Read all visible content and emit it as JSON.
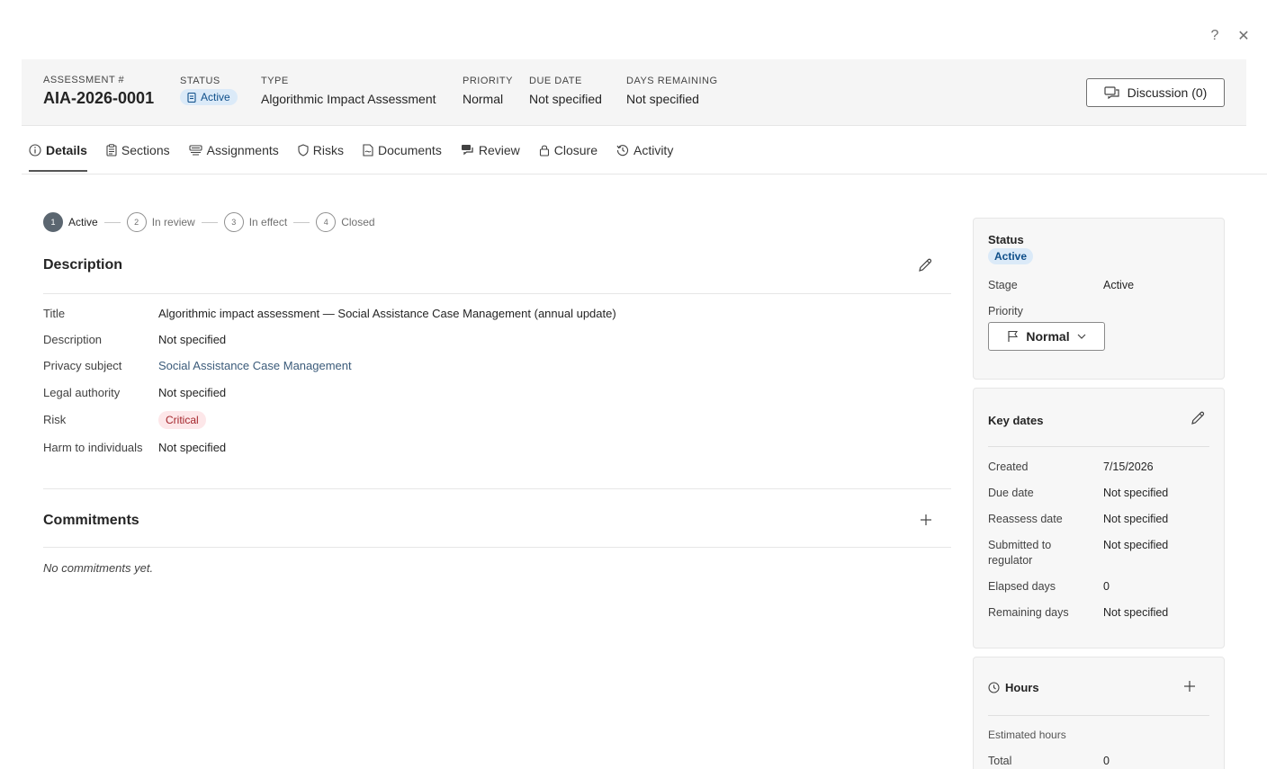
{
  "window": {
    "help_glyph": "?",
    "close_glyph": "✕"
  },
  "header": {
    "assessment_label": "ASSESSMENT #",
    "assessment_id": "AIA-2026-0001",
    "status_label": "STATUS",
    "status_value": "Active",
    "type_label": "TYPE",
    "type_value": "Algorithmic Impact Assessment",
    "priority_label": "PRIORITY",
    "priority_value": "Normal",
    "due_label": "DUE DATE",
    "due_value": "Not specified",
    "remaining_label": "DAYS REMAINING",
    "remaining_value": "Not specified",
    "discussion_label": "Discussion (0)"
  },
  "tabs": [
    {
      "label": "Details",
      "icon": "info-icon",
      "active": true
    },
    {
      "label": "Sections",
      "icon": "clipboard-icon"
    },
    {
      "label": "Assignments",
      "icon": "assignments-icon"
    },
    {
      "label": "Risks",
      "icon": "shield-icon"
    },
    {
      "label": "Documents",
      "icon": "document-icon"
    },
    {
      "label": "Review",
      "icon": "chat-icon"
    },
    {
      "label": "Closure",
      "icon": "lock-icon"
    },
    {
      "label": "Activity",
      "icon": "history-icon"
    }
  ],
  "stepper": [
    {
      "num": "1",
      "label": "Active"
    },
    {
      "num": "2",
      "label": "In review"
    },
    {
      "num": "3",
      "label": "In effect"
    },
    {
      "num": "4",
      "label": "Closed"
    }
  ],
  "description": {
    "title": "Description",
    "fields": [
      {
        "label": "Title",
        "value": "Algorithmic impact assessment — Social Assistance Case Management (annual update)"
      },
      {
        "label": "Description",
        "value": "Not specified"
      },
      {
        "label": "Privacy subject",
        "value": "Social Assistance Case Management"
      },
      {
        "label": "Legal authority",
        "value": "Not specified"
      },
      {
        "label": "Risk",
        "value": "Critical"
      },
      {
        "label": "Harm to individuals",
        "value": "Not specified"
      }
    ]
  },
  "commitments": {
    "title": "Commitments",
    "empty": "No commitments yet."
  },
  "status_card": {
    "title": "Status",
    "status_value": "Active",
    "stage_label": "Stage",
    "stage_value": "Active",
    "priority_label": "Priority",
    "priority_value": "Normal"
  },
  "dates_card": {
    "title": "Key dates",
    "rows": [
      {
        "label": "Created",
        "value": "7/15/2026"
      },
      {
        "label": "Due date",
        "value": "Not specified"
      },
      {
        "label": "Reassess date",
        "value": "Not specified"
      },
      {
        "label": "Submitted to regulator",
        "value": "Not specified"
      },
      {
        "label": "Elapsed days",
        "value": "0"
      },
      {
        "label": "Remaining days",
        "value": "Not specified"
      }
    ]
  },
  "hours_card": {
    "title": "Hours",
    "subtitle": "Estimated hours",
    "total_label": "Total",
    "total_value": "0"
  },
  "colors": {
    "accent_status": "#0f4f8a",
    "status_bg": "#dbeaf8",
    "risk_critical": "#a4262c",
    "risk_bg": "#fde7e9"
  }
}
